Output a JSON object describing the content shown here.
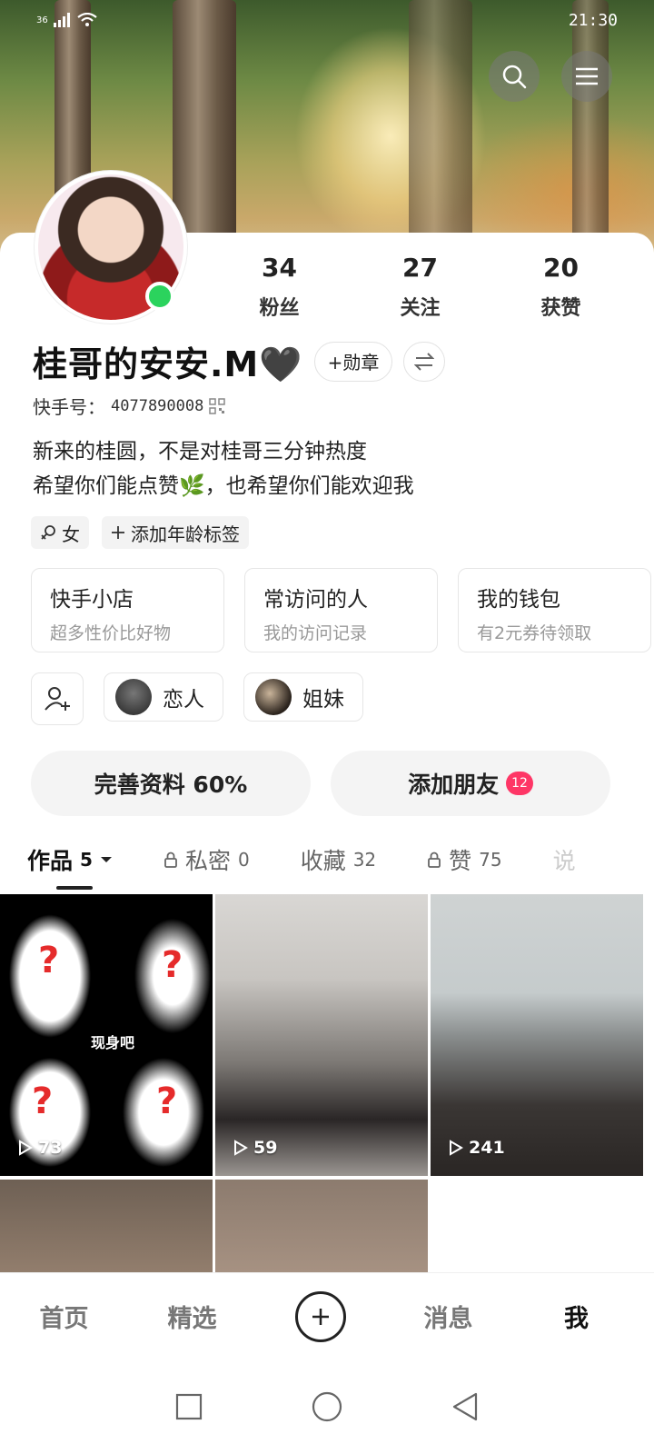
{
  "status_bar": {
    "signal": "36",
    "time": "21:30"
  },
  "profile": {
    "stats": [
      {
        "value": "34",
        "label": "粉丝"
      },
      {
        "value": "27",
        "label": "关注"
      },
      {
        "value": "20",
        "label": "获赞"
      }
    ],
    "username": "桂哥的安安.M🖤",
    "medal_label": "+勋章",
    "id_label": "快手号：",
    "id_value": "4077890008",
    "bio_line1": "新来的桂圆，不是对桂哥三分钟热度",
    "bio_line2": "希望你们能点赞🌿，也希望你们能欢迎我",
    "tags": [
      {
        "icon": "female-icon",
        "label": "女"
      },
      {
        "icon": "plus-icon",
        "label": "添加年龄标签"
      }
    ]
  },
  "quick_cards": [
    {
      "title": "快手小店",
      "subtitle": "超多性价比好物"
    },
    {
      "title": "常访问的人",
      "subtitle": "我的访问记录"
    },
    {
      "title": "我的钱包",
      "subtitle": "有2元券待领取"
    }
  ],
  "groups": [
    {
      "label": "恋人"
    },
    {
      "label": "姐妹"
    }
  ],
  "actions": {
    "complete_profile": "完善资料 60%",
    "complete_profile_progress": 0.6,
    "add_friends": "添加朋友",
    "add_friends_badge": "12"
  },
  "tabs": [
    {
      "label": "作品",
      "count": "5",
      "active": true
    },
    {
      "label": "私密",
      "count": "0",
      "locked": true
    },
    {
      "label": "收藏",
      "count": "32"
    },
    {
      "label": "赞",
      "count": "75",
      "locked": true
    },
    {
      "label": "说",
      "count": ""
    }
  ],
  "works": [
    {
      "plays": "73",
      "overlay_text": "现身吧"
    },
    {
      "plays": "59"
    },
    {
      "plays": "241"
    },
    {
      "plays": ""
    },
    {
      "plays": ""
    }
  ],
  "bottom_nav": [
    {
      "label": "首页"
    },
    {
      "label": "精选"
    },
    {
      "label": ""
    },
    {
      "label": "消息"
    },
    {
      "label": "我",
      "active": true
    }
  ]
}
